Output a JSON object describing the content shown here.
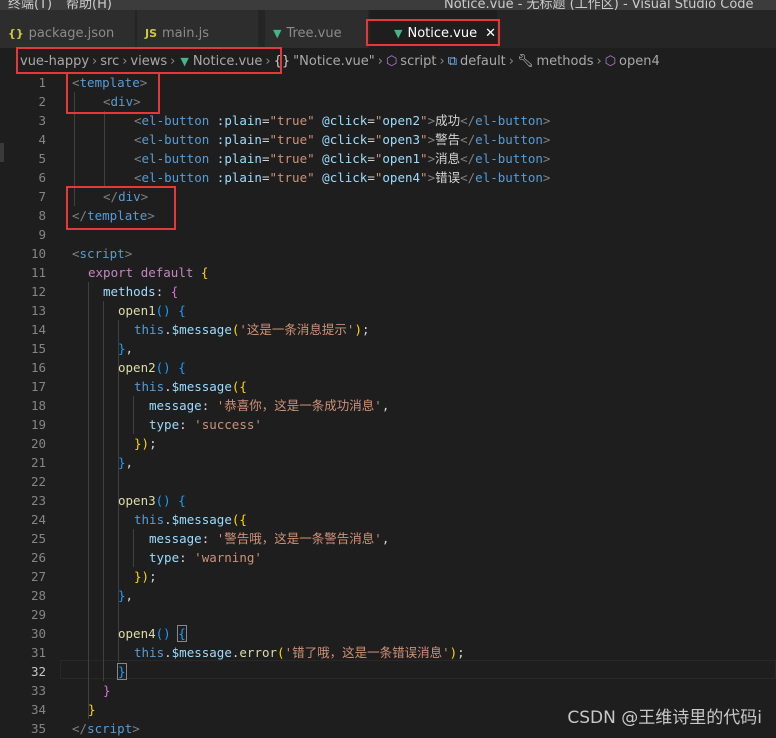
{
  "window": {
    "menu_terminal": "终端(T)",
    "menu_help": "帮助(H)",
    "title": "Notice.vue - 无标题 (工作区) - Visual Studio Code"
  },
  "tabs": [
    {
      "icon": "json-icon",
      "glyph": "{}",
      "label": "package.json"
    },
    {
      "icon": "js-icon",
      "glyph": "JS",
      "label": "main.js"
    },
    {
      "icon": "vue-icon",
      "glyph": "▼",
      "label": "Tree.vue"
    },
    {
      "icon": "vue-icon",
      "glyph": "▼",
      "label": "Notice.vue",
      "active": true
    }
  ],
  "breadcrumb": {
    "items": [
      "vue-happy",
      "src",
      "views",
      "Notice.vue",
      "\"Notice.vue\"",
      "script",
      "default",
      "methods",
      "open4"
    ]
  },
  "editor": {
    "line_numbers": [
      "1",
      "2",
      "3",
      "4",
      "5",
      "6",
      "7",
      "8",
      "9",
      "10",
      "11",
      "12",
      "13",
      "14",
      "15",
      "16",
      "17",
      "18",
      "19",
      "20",
      "21",
      "22",
      "23",
      "24",
      "25",
      "26",
      "27",
      "28",
      "29",
      "30",
      "31",
      "32",
      "33",
      "34",
      "35"
    ],
    "button_labels": [
      "成功",
      "警告",
      "消息",
      "错误"
    ],
    "handlers": [
      "open2",
      "open3",
      "open1",
      "open4"
    ],
    "strings": {
      "msg1": "'这是一条消息提示'",
      "msg2": "'恭喜你，这是一条成功消息'",
      "type2": "'success'",
      "msg3": "'警告哦，这是一条警告消息'",
      "type3": "'warning'",
      "msg4": "'错了哦，这是一条错误消息'"
    }
  },
  "watermark": "CSDN @王维诗里的代码i"
}
